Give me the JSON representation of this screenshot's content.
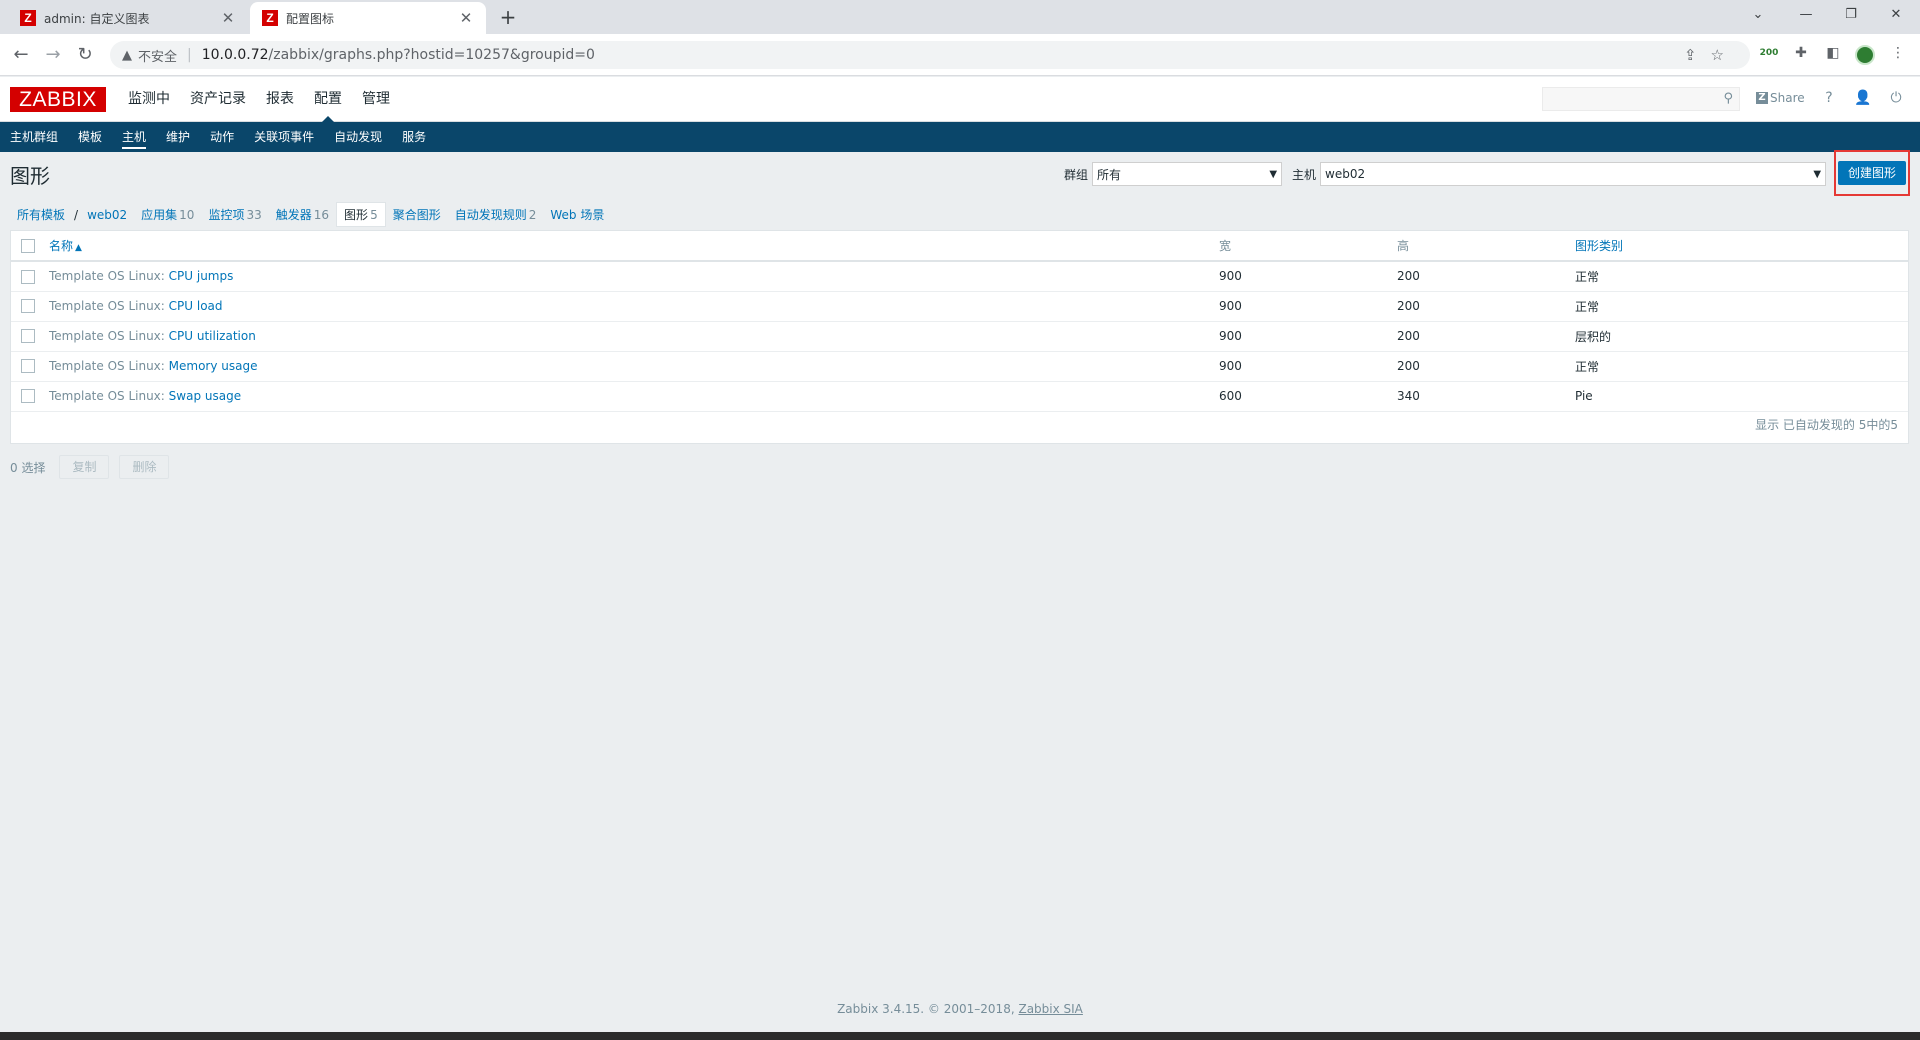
{
  "browser": {
    "tabs": [
      {
        "title": "admin: 自定义图表",
        "favicon": "Z"
      },
      {
        "title": "配置图标",
        "favicon": "Z"
      }
    ],
    "insecure_label": "不安全",
    "url_host": "10.0.0.72",
    "url_path": "/zabbix/graphs.php?hostid=10257&groupid=0",
    "ext_badge": "200"
  },
  "zabbix": {
    "logo": "ZABBIX",
    "top_menu": [
      "监测中",
      "资产记录",
      "报表",
      "配置",
      "管理"
    ],
    "share_label": "Share",
    "help_label": "?",
    "sub_menu": [
      "主机群组",
      "模板",
      "主机",
      "维护",
      "动作",
      "关联项事件",
      "自动发现",
      "服务"
    ],
    "page_title": "图形",
    "filter": {
      "group_label": "群组",
      "group_value": "所有",
      "host_label": "主机",
      "host_value": "web02"
    },
    "create_button": "创建图形",
    "object_nav": {
      "all_templates": "所有模板",
      "host": "web02",
      "items": [
        {
          "label": "应用集",
          "count": "10"
        },
        {
          "label": "监控项",
          "count": "33"
        },
        {
          "label": "触发器",
          "count": "16"
        },
        {
          "label": "图形",
          "count": "5"
        },
        {
          "label": "聚合图形",
          "count": ""
        },
        {
          "label": "自动发现规则",
          "count": "2"
        },
        {
          "label": "Web 场景",
          "count": ""
        }
      ]
    },
    "table": {
      "headers": {
        "name": "名称",
        "width": "宽",
        "height": "高",
        "type": "图形类别"
      },
      "rows": [
        {
          "prefix": "Template OS Linux:",
          "name": "CPU jumps",
          "width": "900",
          "height": "200",
          "type": "正常"
        },
        {
          "prefix": "Template OS Linux:",
          "name": "CPU load",
          "width": "900",
          "height": "200",
          "type": "正常"
        },
        {
          "prefix": "Template OS Linux:",
          "name": "CPU utilization",
          "width": "900",
          "height": "200",
          "type": "层积的"
        },
        {
          "prefix": "Template OS Linux:",
          "name": "Memory usage",
          "width": "900",
          "height": "200",
          "type": "正常"
        },
        {
          "prefix": "Template OS Linux:",
          "name": "Swap usage",
          "width": "600",
          "height": "340",
          "type": "Pie"
        }
      ],
      "summary": "显示 已自动发现的 5中的5"
    },
    "actions": {
      "selected": "0 选择",
      "copy": "复制",
      "delete": "删除"
    },
    "footer": {
      "text": "Zabbix 3.4.15. © 2001–2018,",
      "link": "Zabbix SIA"
    }
  }
}
